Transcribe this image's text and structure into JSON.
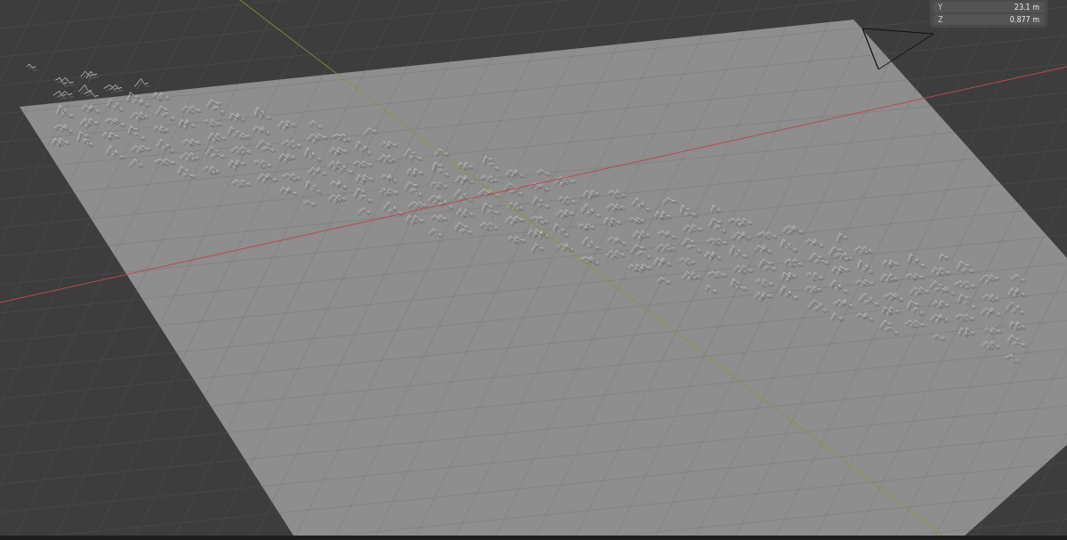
{
  "dimensions_panel": {
    "rows": [
      {
        "axis": "Y",
        "value": "23.1 m"
      },
      {
        "axis": "Z",
        "value": "0.877 m"
      }
    ]
  }
}
